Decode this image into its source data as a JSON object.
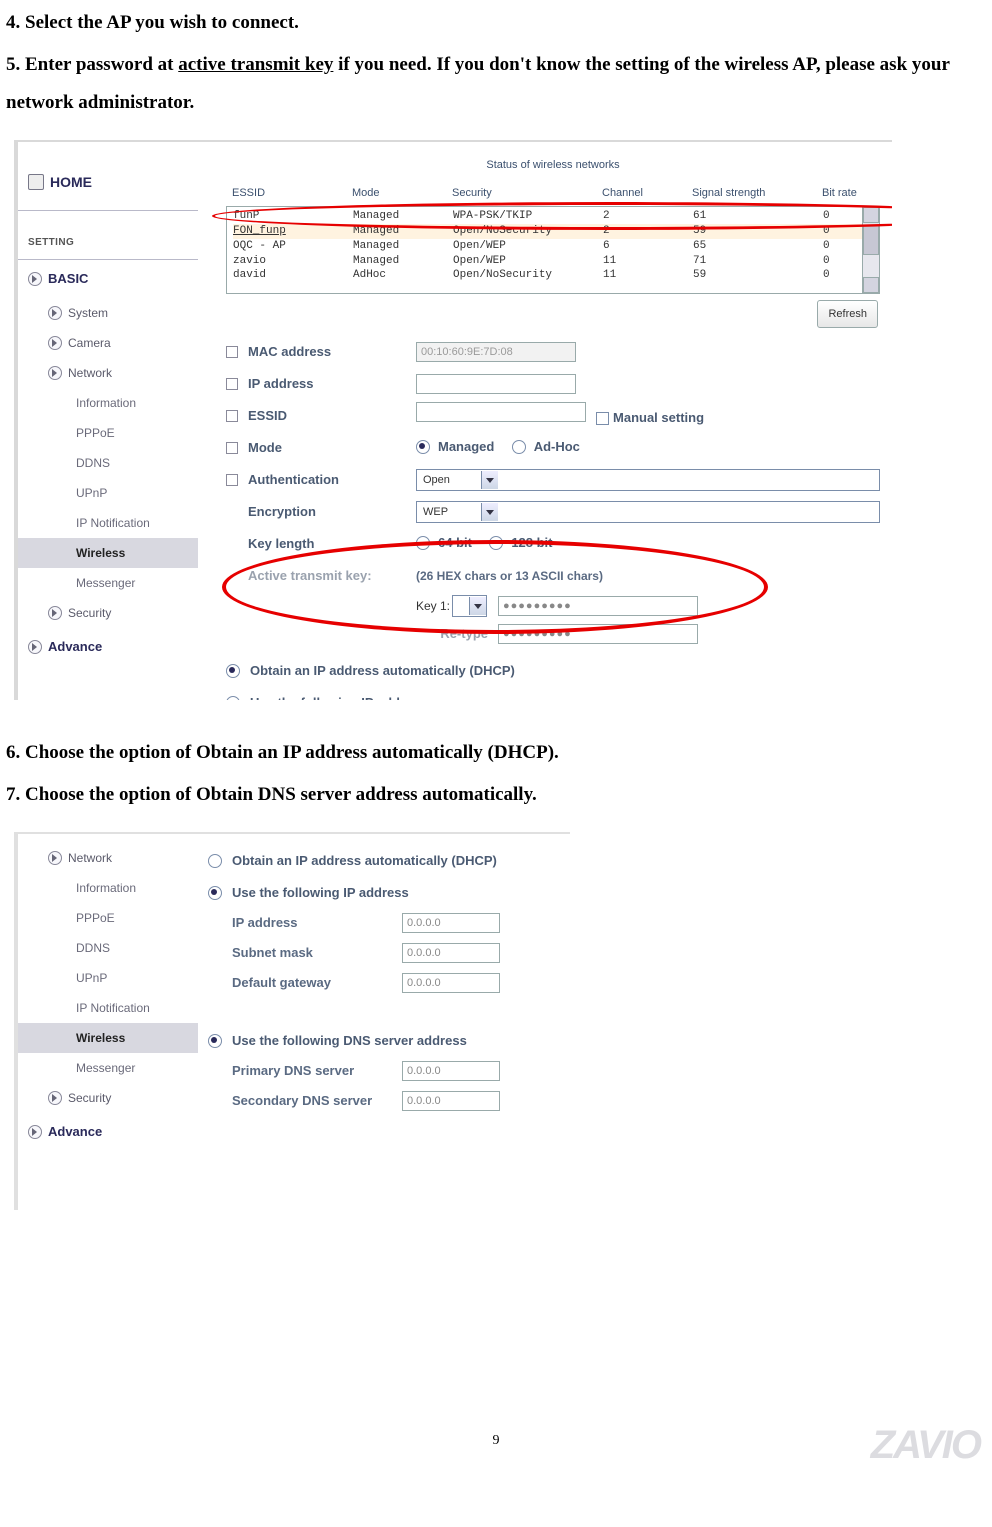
{
  "page_number": "9",
  "brand": "ZAVIO",
  "instructions": {
    "step4": "4. Select the AP you wish to connect.",
    "step5_pre": "5. Enter password at ",
    "step5_ul": "active transmit key",
    "step5_post": " if you need. If you don't know the setting of the wireless AP, please ask your network administrator.",
    "step6": "6. Choose the option of Obtain an IP address automatically (DHCP).",
    "step7": "7. Choose the option of Obtain DNS server address automatically."
  },
  "fig1": {
    "nav": {
      "home": "HOME",
      "setting": "SETTING",
      "basic": "BASIC",
      "basic_items": [
        "System",
        "Camera",
        "Network"
      ],
      "network_subs": [
        "Information",
        "PPPoE",
        "DDNS",
        "UPnP",
        "IP Notification",
        "Wireless",
        "Messenger"
      ],
      "security": "Security",
      "advance": "Advance"
    },
    "networks": {
      "title": "Status of wireless networks",
      "columns": [
        "ESSID",
        "Mode",
        "Security",
        "Channel",
        "Signal strength",
        "Bit rate"
      ],
      "rows": [
        {
          "essid": "funP",
          "mode": "Managed",
          "sec": "WPA-PSK/TKIP",
          "ch": "2",
          "sig": "61",
          "bit": "0"
        },
        {
          "essid": "FON_funp",
          "mode": "Managed",
          "sec": "Open/NoSecurity",
          "ch": "2",
          "sig": "59",
          "bit": "0"
        },
        {
          "essid": "OQC - AP",
          "mode": "Managed",
          "sec": "Open/WEP",
          "ch": "6",
          "sig": "65",
          "bit": "0"
        },
        {
          "essid": "zavio",
          "mode": "Managed",
          "sec": "Open/WEP",
          "ch": "11",
          "sig": "71",
          "bit": "0"
        },
        {
          "essid": "david",
          "mode": "AdHoc",
          "sec": "Open/NoSecurity",
          "ch": "11",
          "sig": "59",
          "bit": "0"
        }
      ],
      "refresh": "Refresh"
    },
    "form": {
      "mac_label": "MAC address",
      "mac_value": "00:10:60:9E:7D:08",
      "ip_label": "IP address",
      "essid_label": "ESSID",
      "manual_setting": "Manual setting",
      "mode_label": "Mode",
      "mode_managed": "Managed",
      "mode_adhoc": "Ad-Hoc",
      "auth_label": "Authentication",
      "auth_value": "Open",
      "enc_label": "Encryption",
      "enc_value": "WEP",
      "keylen_label": "Key length",
      "keylen_64": "64 bit",
      "keylen_128": "128 bit",
      "atk_label": "Active transmit key:",
      "atk_note": "(26 HEX chars or 13 ASCII chars)",
      "key1_label": "Key 1:",
      "key_masked": "●●●●●●●●●",
      "retype_label": "Re-type",
      "retype_masked": "●●●●●●●●●",
      "dhcp_label": "Obtain an IP address automatically (DHCP)",
      "static_label": "Use the following IP address"
    }
  },
  "fig2": {
    "nav": {
      "network": "Network",
      "subs": [
        "Information",
        "PPPoE",
        "DDNS",
        "UPnP",
        "IP Notification",
        "Wireless",
        "Messenger"
      ],
      "security": "Security",
      "advance": "Advance"
    },
    "form": {
      "dhcp_label": "Obtain an IP address automatically (DHCP)",
      "static_label": "Use the following IP address",
      "ip_label": "IP address",
      "ip_value": "0.0.0.0",
      "subnet_label": "Subnet mask",
      "subnet_value": "0.0.0.0",
      "gw_label": "Default gateway",
      "gw_value": "0.0.0.0",
      "dns_label": "Use the following DNS server address",
      "pdns_label": "Primary DNS server",
      "pdns_value": "0.0.0.0",
      "sdns_label": "Secondary DNS server",
      "sdns_value": "0.0.0.0"
    }
  }
}
